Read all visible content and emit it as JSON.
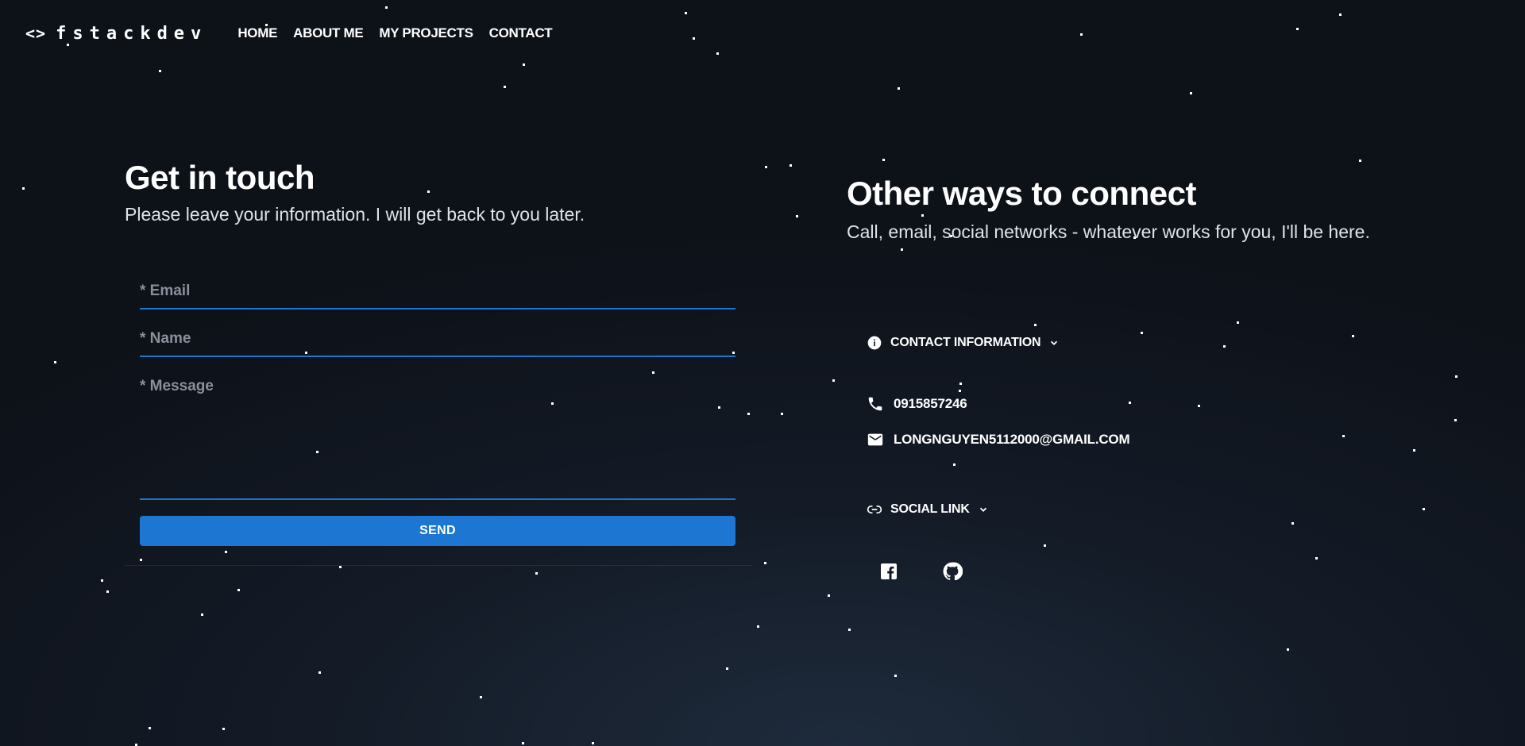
{
  "nav": {
    "logo_icon": "<>",
    "logo_text": "fstackdev",
    "links": [
      "HOME",
      "ABOUT ME",
      "MY PROJECTS",
      "CONTACT"
    ]
  },
  "contact_form": {
    "title": "Get in touch",
    "subtitle": "Please leave your information. I will get back to you later.",
    "email_placeholder": "* Email",
    "name_placeholder": "* Name",
    "message_placeholder": "* Message",
    "send_label": "SEND"
  },
  "other_ways": {
    "title": "Other ways to connect",
    "subtitle": "Call, email, social networks - whatever works for you, I'll be here.",
    "contact_info": {
      "label": "CONTACT INFORMATION",
      "icon": "info-icon",
      "phone": "0915857246",
      "email": "LONGNGUYEN5112000@GMAIL.COM"
    },
    "social": {
      "label": "SOCIAL LINK",
      "icon": "link-icon",
      "links": [
        "facebook-icon",
        "github-icon"
      ]
    }
  },
  "colors": {
    "accent": "#1c76d2",
    "background": "#0d1118",
    "text": "#ffffff"
  }
}
